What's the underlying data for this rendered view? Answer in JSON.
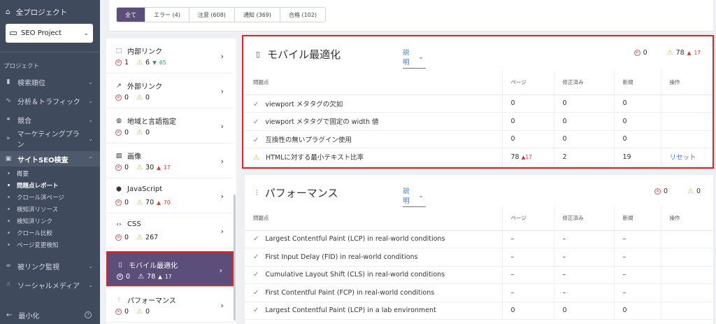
{
  "sidebar": {
    "all_projects": "全プロジェクト",
    "project_name": "SEO Project",
    "section_label": "プロジェクト",
    "nav": [
      {
        "label": "検索順位",
        "icon": "bar-chart-icon"
      },
      {
        "label": "分析＆トラフィック",
        "icon": "pulse-icon"
      },
      {
        "label": "競合",
        "icon": "competitors-icon"
      },
      {
        "label": "マーケティングプラン",
        "icon": "plan-icon"
      },
      {
        "label": "サイトSEO検査",
        "icon": "audit-icon"
      }
    ],
    "sub_items": [
      "概要",
      "問題点レポート",
      "クロール済ページ",
      "検知済リソース",
      "検知済リンク",
      "クロール比較",
      "ページ変更検知"
    ],
    "nav_bottom": [
      {
        "label": "被リンク監視",
        "icon": "link-icon"
      },
      {
        "label": "ソーシャルメディア",
        "icon": "thumbs-up-icon"
      }
    ],
    "minimize": "最小化",
    "help": "?"
  },
  "filters": [
    "全て",
    "エラー (4)",
    "注意 (608)",
    "通知 (369)",
    "合格 (102)"
  ],
  "categories": [
    {
      "label": "内部リンク",
      "icon": "internal-link-icon",
      "errors": "1",
      "warnings": "6",
      "delta": "65",
      "delta_dir": "down"
    },
    {
      "label": "外部リンク",
      "icon": "external-link-icon",
      "errors": "0",
      "warnings": "0",
      "delta": "",
      "delta_dir": ""
    },
    {
      "label": "地域と言語指定",
      "icon": "globe-icon",
      "errors": "0",
      "warnings": "0",
      "delta": "",
      "delta_dir": ""
    },
    {
      "label": "画像",
      "icon": "image-icon",
      "errors": "0",
      "warnings": "30",
      "delta": "17",
      "delta_dir": "up"
    },
    {
      "label": "JavaScript",
      "icon": "javascript-icon",
      "errors": "0",
      "warnings": "70",
      "delta": "70",
      "delta_dir": "up"
    },
    {
      "label": "CSS",
      "icon": "code-icon",
      "errors": "0",
      "warnings": "267",
      "delta": "",
      "delta_dir": ""
    },
    {
      "label": "モバイル最適化",
      "icon": "mobile-icon",
      "errors": "0",
      "warnings": "78",
      "delta": "17",
      "delta_dir": "up"
    },
    {
      "label": "パフォーマンス",
      "icon": "sliders-icon",
      "errors": "0",
      "warnings": "0",
      "delta": "",
      "delta_dir": ""
    }
  ],
  "mobile_panel": {
    "title": "モバイル最適化",
    "explain": "説明",
    "errors": "0",
    "warnings": "78",
    "warnings_delta": "17",
    "columns": [
      "問題点",
      "ページ",
      "修正済み",
      "新規",
      "操作"
    ],
    "rows": [
      {
        "status": "pass",
        "issue": "viewport メタタグの欠如",
        "pages": "0",
        "pages_delta": "",
        "fixed": "0",
        "new": "0",
        "action": ""
      },
      {
        "status": "pass",
        "issue": "viewport メタタグで固定の width 値",
        "pages": "0",
        "pages_delta": "",
        "fixed": "0",
        "new": "0",
        "action": ""
      },
      {
        "status": "pass",
        "issue": "互換性の無いプラグイン使用",
        "pages": "0",
        "pages_delta": "",
        "fixed": "0",
        "new": "0",
        "action": ""
      },
      {
        "status": "warn",
        "issue": "HTMLに対する最小テキスト比率",
        "pages": "78",
        "pages_delta": "17",
        "fixed": "2",
        "new": "19",
        "action": "リセット"
      }
    ]
  },
  "perf_panel": {
    "title": "パフォーマンス",
    "explain": "説明",
    "errors": "0",
    "warnings": "0",
    "columns": [
      "問題点",
      "ページ",
      "修正済み",
      "新規",
      "操作"
    ],
    "rows": [
      {
        "status": "pass",
        "issue": "Largest Contentful Paint (LCP) in real-world conditions",
        "pages": "–",
        "fixed": "–",
        "new": "–",
        "action": ""
      },
      {
        "status": "pass",
        "issue": "First Input Delay (FID) in real-world conditions",
        "pages": "–",
        "fixed": "–",
        "new": "–",
        "action": ""
      },
      {
        "status": "pass",
        "issue": "Cumulative Layout Shift (CLS) in real-world conditions",
        "pages": "–",
        "fixed": "–",
        "new": "–",
        "action": ""
      },
      {
        "status": "pass",
        "issue": "First Contentful Paint (FCP) in real-world conditions",
        "pages": "–",
        "fixed": "–",
        "new": "–",
        "action": ""
      },
      {
        "status": "pass",
        "issue": "Largest Contentful Paint (LCP) in a lab environment",
        "pages": "0",
        "fixed": "0",
        "new": "0",
        "action": ""
      }
    ]
  }
}
